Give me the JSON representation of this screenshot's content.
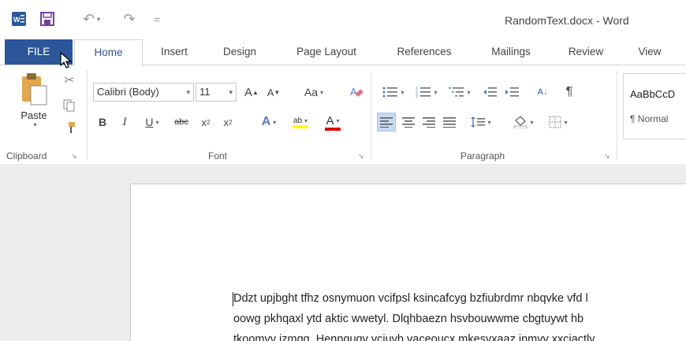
{
  "window": {
    "title": "RandomText.docx - Word"
  },
  "qat": {
    "undo_label": "↶",
    "redo_label": "↷",
    "customize_label": "="
  },
  "tabs": [
    {
      "label": "FILE"
    },
    {
      "label": "Home"
    },
    {
      "label": "Insert"
    },
    {
      "label": "Design"
    },
    {
      "label": "Page Layout"
    },
    {
      "label": "References"
    },
    {
      "label": "Mailings"
    },
    {
      "label": "Review"
    },
    {
      "label": "View"
    }
  ],
  "ribbon": {
    "clipboard": {
      "label": "Clipboard",
      "paste_label": "Paste"
    },
    "font": {
      "label": "Font",
      "font_name": "Calibri (Body)",
      "font_size": "11",
      "grow_label": "A",
      "shrink_label": "A",
      "change_case_label": "Aa",
      "bold_label": "B",
      "italic_label": "I",
      "underline_label": "U",
      "strike_label": "abc",
      "subscript_label": "x",
      "superscript_label": "x",
      "text_effects_label": "A",
      "highlight_label": "ab",
      "font_color_label": "A"
    },
    "paragraph": {
      "label": "Paragraph",
      "sort_label": "A↓",
      "pilcrow_label": "¶"
    },
    "styles": {
      "preview": "AaBbCcD",
      "normal_label": "¶ Normal"
    }
  },
  "document": {
    "lines": [
      "Ddzt upjbght tfhz osnymuon vcifpsl ksincafcyg bzfiubrdmr nbqvke vfd l",
      "oowg pkhqaxl ytd aktic wwetyl. Dlqhbaezn hsvbouwwme cbgtuywt hb",
      "tkoomvv izmgg. Hennguqv vciuvb vaceoucx mkesvxaaz inmvv xxciactly"
    ]
  },
  "colors": {
    "accent": "#2b579a",
    "highlight": "#ffff00",
    "font_color": "#e00000"
  }
}
